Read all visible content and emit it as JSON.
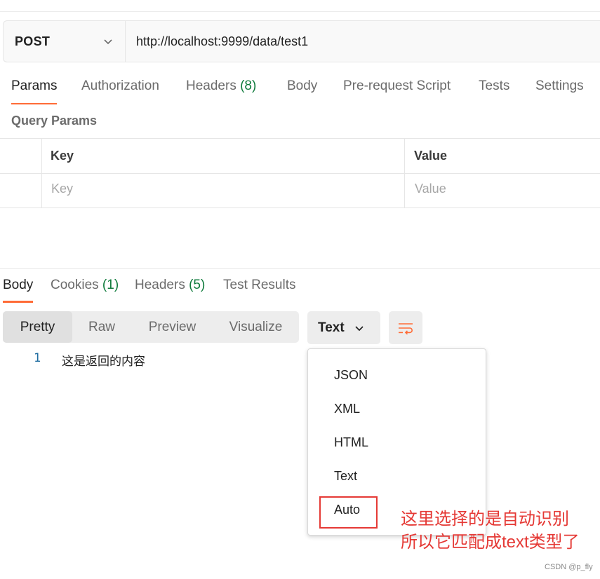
{
  "request": {
    "method": "POST",
    "url": "http://localhost:9999/data/test1"
  },
  "request_tabs": [
    {
      "label": "Params",
      "active": true
    },
    {
      "label": "Authorization"
    },
    {
      "label": "Headers ",
      "count": "(8)"
    },
    {
      "label": "Body"
    },
    {
      "label": "Pre-request Script"
    },
    {
      "label": "Tests"
    },
    {
      "label": "Settings"
    }
  ],
  "query_params": {
    "title": "Query Params",
    "columns": [
      "Key",
      "Value"
    ],
    "placeholders": {
      "key": "Key",
      "value": "Value"
    }
  },
  "response_tabs": [
    {
      "label": "Body",
      "active": true
    },
    {
      "label": "Cookies ",
      "count": "(1)"
    },
    {
      "label": "Headers ",
      "count": "(5)"
    },
    {
      "label": "Test Results"
    }
  ],
  "view_modes": [
    "Pretty",
    "Raw",
    "Preview",
    "Visualize"
  ],
  "active_view": "Pretty",
  "format": {
    "selected": "Text",
    "options": [
      "JSON",
      "XML",
      "HTML",
      "Text",
      "Auto"
    ],
    "highlighted": "Auto"
  },
  "code": {
    "line_number": "1",
    "content": "这是返回的内容"
  },
  "annotation": {
    "line1": "这里选择的是自动识别",
    "line2": "所以它匹配成text类型了"
  },
  "watermark": "CSDN @p_fly",
  "colors": {
    "accent": "#ff6c37",
    "count_green": "#0f7b3c",
    "annotation_red": "#e53935"
  },
  "icons": {
    "method_dropdown": "chevron-down-icon",
    "format_dropdown": "chevron-down-icon",
    "wrap": "wrap-lines-icon"
  }
}
